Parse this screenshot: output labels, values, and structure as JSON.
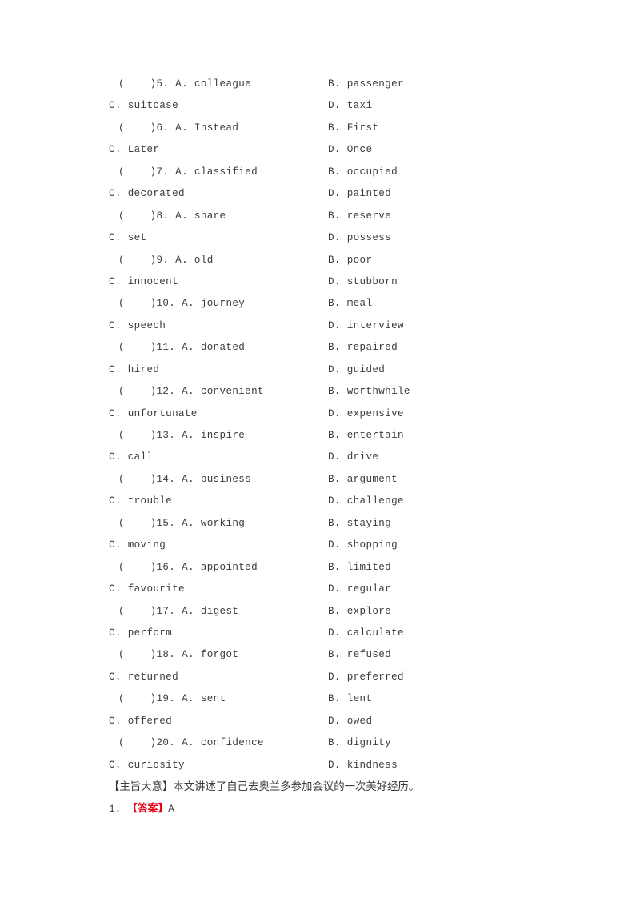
{
  "document": {
    "type": "english-cloze-answer-sheet",
    "background_color": "#ffffff",
    "text_color": "#3b3b3b",
    "accent_color": "#e60012"
  },
  "questions": [
    {
      "number": "5",
      "marker": "(    )5. ",
      "a_label": "A. ",
      "a": "colleague",
      "b_label": "B. ",
      "b": "passenger",
      "c_label": "C. ",
      "c": "suitcase",
      "d_label": "D. ",
      "d": "taxi"
    },
    {
      "number": "6",
      "marker": "(    )6. ",
      "a_label": "A. ",
      "a": "Instead",
      "b_label": "B. ",
      "b": "First",
      "c_label": "C. ",
      "c": "Later",
      "d_label": "D. ",
      "d": "Once"
    },
    {
      "number": "7",
      "marker": "(    )7. ",
      "a_label": "A. ",
      "a": "classified",
      "b_label": "B. ",
      "b": "occupied",
      "c_label": "C. ",
      "c": "decorated",
      "d_label": "D. ",
      "d": "painted"
    },
    {
      "number": "8",
      "marker": "(    )8. ",
      "a_label": "A. ",
      "a": "share",
      "b_label": "B. ",
      "b": "reserve",
      "c_label": "C. ",
      "c": "set",
      "d_label": "D. ",
      "d": "possess"
    },
    {
      "number": "9",
      "marker": "(    )9. ",
      "a_label": "A. ",
      "a": "old",
      "b_label": "B. ",
      "b": "poor",
      "c_label": "C. ",
      "c": "innocent",
      "d_label": "D. ",
      "d": "stubborn"
    },
    {
      "number": "10",
      "marker": "(    )10. ",
      "a_label": "A. ",
      "a": "journey",
      "b_label": "B. ",
      "b": "meal",
      "c_label": "C. ",
      "c": "speech",
      "d_label": "D. ",
      "d": "interview"
    },
    {
      "number": "11",
      "marker": "(    )11. ",
      "a_label": "A. ",
      "a": "donated",
      "b_label": "B. ",
      "b": "repaired",
      "c_label": "C. ",
      "c": "hired",
      "d_label": "D. ",
      "d": "guided"
    },
    {
      "number": "12",
      "marker": "(    )12. ",
      "a_label": "A. ",
      "a": "convenient",
      "b_label": "B. ",
      "b": "worthwhile",
      "c_label": "C. ",
      "c": "unfortunate",
      "d_label": "D. ",
      "d": "expensive"
    },
    {
      "number": "13",
      "marker": "(    )13. ",
      "a_label": "A. ",
      "a": "inspire",
      "b_label": "B. ",
      "b": "entertain",
      "c_label": "C. ",
      "c": "call",
      "d_label": "D. ",
      "d": "drive"
    },
    {
      "number": "14",
      "marker": "(    )14. ",
      "a_label": "A. ",
      "a": "business",
      "b_label": "B. ",
      "b": "argument",
      "c_label": "C. ",
      "c": "trouble",
      "d_label": "D. ",
      "d": "challenge"
    },
    {
      "number": "15",
      "marker": "(    )15. ",
      "a_label": "A. ",
      "a": "working",
      "b_label": "B. ",
      "b": "staying",
      "c_label": "C. ",
      "c": "moving",
      "d_label": "D. ",
      "d": "shopping"
    },
    {
      "number": "16",
      "marker": "(    )16. ",
      "a_label": "A. ",
      "a": "appointed",
      "b_label": "B. ",
      "b": "limited",
      "c_label": "C. ",
      "c": "favourite",
      "d_label": "D. ",
      "d": "regular"
    },
    {
      "number": "17",
      "marker": "(    )17. ",
      "a_label": "A. ",
      "a": "digest",
      "b_label": "B. ",
      "b": "explore",
      "c_label": "C. ",
      "c": "perform",
      "d_label": "D. ",
      "d": "calculate"
    },
    {
      "number": "18",
      "marker": "(    )18. ",
      "a_label": "A. ",
      "a": "forgot",
      "b_label": "B. ",
      "b": "refused",
      "c_label": "C. ",
      "c": "returned",
      "d_label": "D. ",
      "d": "preferred"
    },
    {
      "number": "19",
      "marker": "(    )19. ",
      "a_label": "A. ",
      "a": "sent",
      "b_label": "B. ",
      "b": "lent",
      "c_label": "C. ",
      "c": "offered",
      "d_label": "D. ",
      "d": "owed"
    },
    {
      "number": "20",
      "marker": "(    )20. ",
      "a_label": "A. ",
      "a": "confidence",
      "b_label": "B. ",
      "b": "dignity",
      "c_label": "C. ",
      "c": "curiosity",
      "d_label": "D. ",
      "d": "kindness"
    }
  ],
  "summary": {
    "label": "【主旨大意】",
    "text": "本文讲述了自己去奥兰多参加会议的一次美好经历。",
    "full": "【主旨大意】本文讲述了自己去奥兰多参加会议的一次美好经历。"
  },
  "answers": [
    {
      "number": "1. ",
      "tag": "【答案】",
      "value": "A"
    }
  ]
}
